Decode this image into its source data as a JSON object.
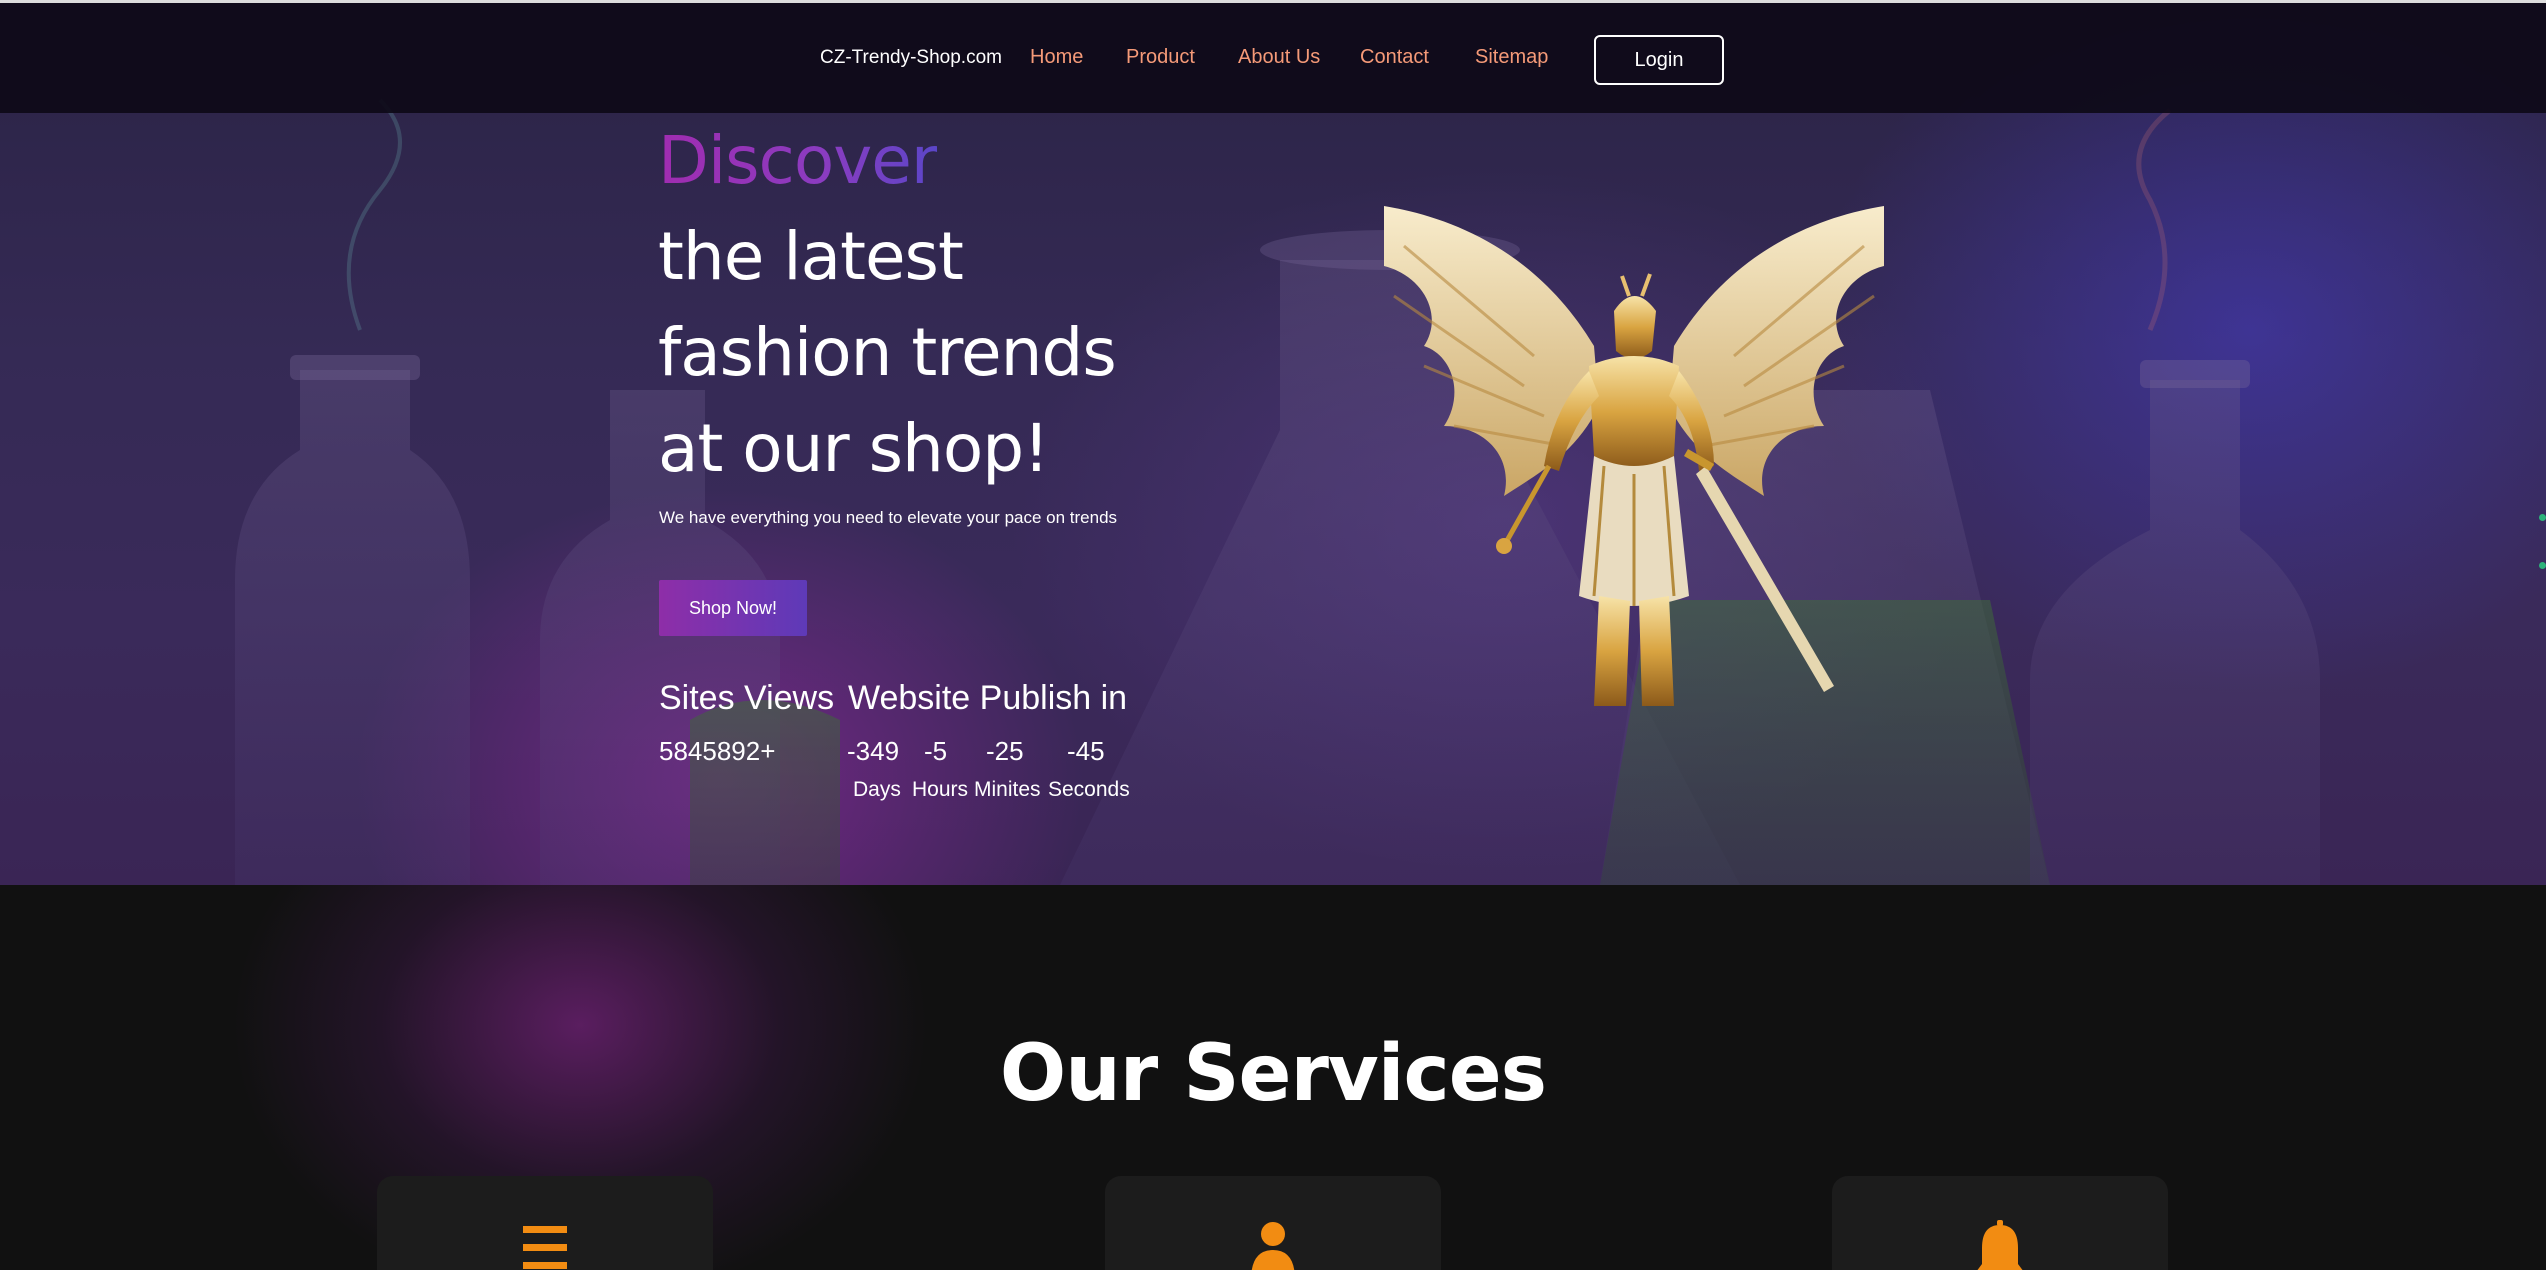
{
  "navbar": {
    "brand": "CZ-Trendy-Shop.com",
    "links": [
      {
        "label": "Home"
      },
      {
        "label": "Product"
      },
      {
        "label": "About Us"
      },
      {
        "label": "Contact"
      },
      {
        "label": "Sitemap"
      }
    ],
    "login_label": "Login",
    "link_color": "#f59a78"
  },
  "hero": {
    "headline_accent": "Discover",
    "headline_lines": [
      "the latest",
      "fashion trends",
      "at our shop!"
    ],
    "subtitle": "We have everything you need to elevate your pace on trends",
    "cta_label": "Shop Now!",
    "accent_colors": [
      "#a02cb0",
      "#5b46c8"
    ],
    "image_subject": "golden winged angel warrior with sword"
  },
  "stats": {
    "views_heading": "Sites Views",
    "views_value": "5845892+",
    "countdown_heading": "Website Publish in",
    "countdown": [
      {
        "value": "-349",
        "unit": "Days"
      },
      {
        "value": "-5",
        "unit": "Hours"
      },
      {
        "value": "-25",
        "unit": "Minites"
      },
      {
        "value": "-45",
        "unit": "Seconds"
      }
    ]
  },
  "services": {
    "title": "Our Services",
    "icon_color": "#f28c12",
    "cards": [
      {
        "icon": "menu-icon"
      },
      {
        "icon": "user-icon"
      },
      {
        "icon": "bell-icon"
      }
    ]
  }
}
